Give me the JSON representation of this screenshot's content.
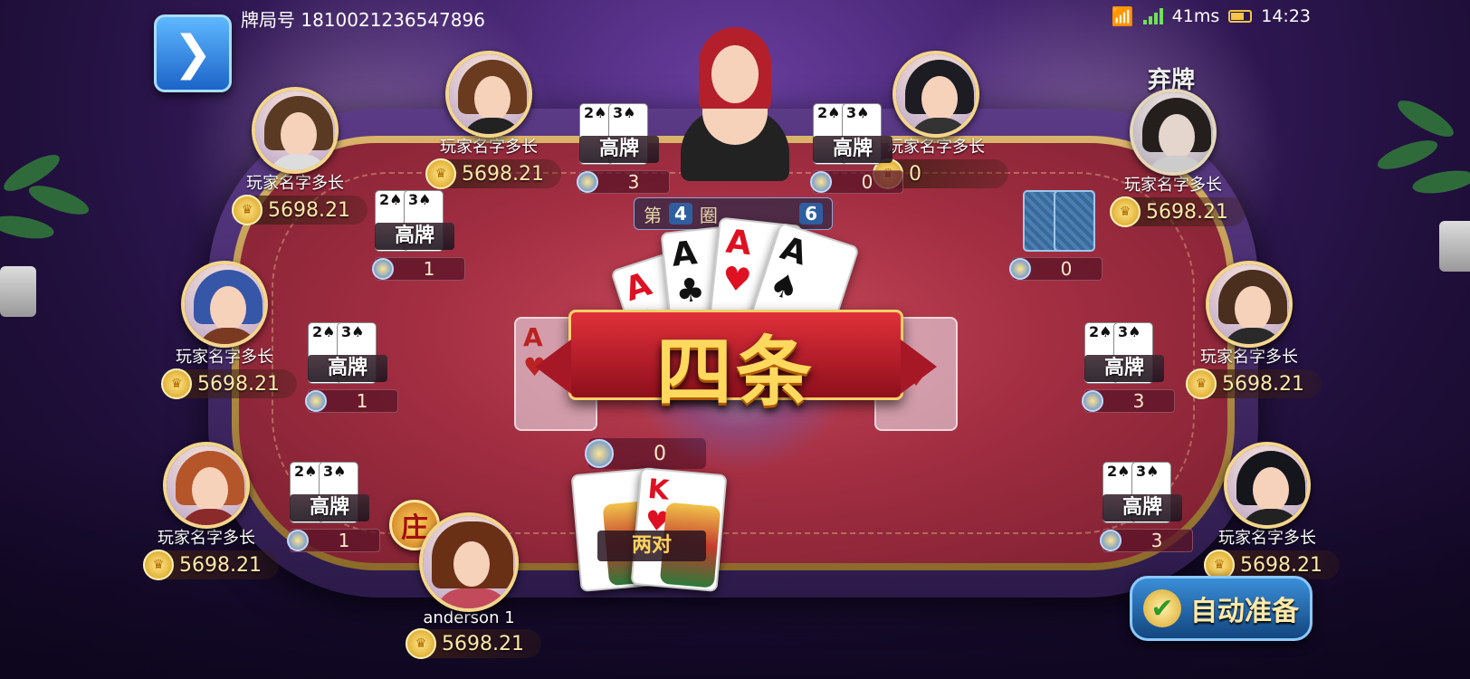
{
  "header": {
    "game_id": "牌局号 1810021236547896",
    "latency": "41ms",
    "time": "14:23",
    "menu_icon": "chevron-right-icon"
  },
  "table": {
    "round_prefix": "第",
    "round_number": "4",
    "round_suffix": "圈",
    "round_total": "6",
    "pot_bet": "0",
    "community_cards": [
      {
        "rank": "A",
        "suit": "♥"
      },
      {
        "rank": "",
        "suit": "♦"
      }
    ]
  },
  "win_banner": {
    "title": "四条",
    "cards": [
      {
        "rank": "A",
        "suit": "♦"
      },
      {
        "rank": "A",
        "suit": "♣"
      },
      {
        "rank": "A",
        "suit": "♥"
      },
      {
        "rank": "A",
        "suit": "♠"
      }
    ]
  },
  "players": [
    {
      "name": "玩家名字多长",
      "coins": "5698.21",
      "hand_label": "高牌",
      "cards": [
        "2♠",
        "3♠"
      ],
      "bet": "1",
      "folded": false
    },
    {
      "name": "玩家名字多长",
      "coins": "5698.21",
      "hand_label": "高牌",
      "cards": [
        "2♠",
        "3♠"
      ],
      "bet": "3",
      "folded": false
    },
    {
      "name": "玩家名字多长",
      "coins": "0",
      "hand_label": "高牌",
      "cards": [
        "2♠",
        "3♠"
      ],
      "bet": "0",
      "folded": false
    },
    {
      "name": "玩家名字多长",
      "coins": "5698.21",
      "hand_label": "",
      "cards": [],
      "bet": "0",
      "folded": true,
      "fold_label": "弃牌"
    },
    {
      "name": "玩家名字多长",
      "coins": "5698.21",
      "hand_label": "高牌",
      "cards": [
        "2♠",
        "3♠"
      ],
      "bet": "1",
      "folded": false
    },
    {
      "name": "玩家名字多长",
      "coins": "5698.21",
      "hand_label": "高牌",
      "cards": [
        "2♠",
        "3♠"
      ],
      "bet": "3",
      "folded": false
    },
    {
      "name": "玩家名字多长",
      "coins": "5698.21",
      "hand_label": "高牌",
      "cards": [
        "2♠",
        "3♠"
      ],
      "bet": "1",
      "folded": false
    },
    {
      "name": "玩家名字多长",
      "coins": "5698.21",
      "hand_label": "高牌",
      "cards": [
        "2♠",
        "3♠"
      ],
      "bet": "3",
      "folded": false
    }
  ],
  "me": {
    "name": "anderson 1",
    "coins": "5698.21",
    "hand_label": "两对",
    "cards": [
      {
        "rank": "K",
        "suit": "♣"
      },
      {
        "rank": "K",
        "suit": "♥"
      }
    ],
    "banker_badge": "庄"
  },
  "actions": {
    "auto_ready": "自动准备"
  },
  "colors": {
    "felt": "#a32e42",
    "gold": "#ffd95e",
    "button_blue": "#1c64c9"
  }
}
